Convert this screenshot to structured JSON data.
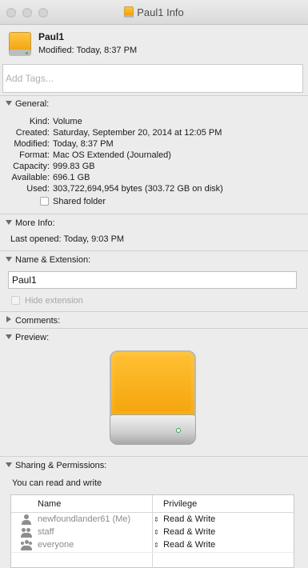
{
  "window": {
    "title": "Paul1 Info"
  },
  "header": {
    "name": "Paul1",
    "modified": "Modified: Today, 8:37 PM"
  },
  "tags": {
    "placeholder": "Add Tags..."
  },
  "general": {
    "label": "General:",
    "rows": [
      {
        "key": "Kind:",
        "value": "Volume"
      },
      {
        "key": "Created:",
        "value": "Saturday, September 20, 2014 at 12:05 PM"
      },
      {
        "key": "Modified:",
        "value": "Today, 8:37 PM"
      },
      {
        "key": "Format:",
        "value": "Mac OS Extended (Journaled)"
      },
      {
        "key": "Capacity:",
        "value": "999.83 GB"
      },
      {
        "key": "Available:",
        "value": "696.1 GB"
      },
      {
        "key": "Used:",
        "value": "303,722,694,954 bytes (303.72 GB on disk)"
      }
    ],
    "shared_folder": {
      "label": "Shared folder",
      "checked": false
    }
  },
  "more_info": {
    "label": "More Info:",
    "last_opened": "Last opened: Today, 9:03 PM"
  },
  "name_ext": {
    "label": "Name & Extension:",
    "value": "Paul1",
    "hide_extension": {
      "label": "Hide extension",
      "checked": false,
      "enabled": false
    }
  },
  "comments": {
    "label": "Comments:"
  },
  "preview": {
    "label": "Preview:"
  },
  "sharing": {
    "label": "Sharing & Permissions:",
    "summary": "You can read and write",
    "columns": {
      "name": "Name",
      "privilege": "Privilege"
    },
    "rows": [
      {
        "name": "newfoundlander61 (Me)",
        "privilege": "Read & Write",
        "icon": "single-user-icon"
      },
      {
        "name": "staff",
        "privilege": "Read & Write",
        "icon": "group-icon"
      },
      {
        "name": "everyone",
        "privilege": "Read & Write",
        "icon": "everyone-icon"
      }
    ]
  }
}
